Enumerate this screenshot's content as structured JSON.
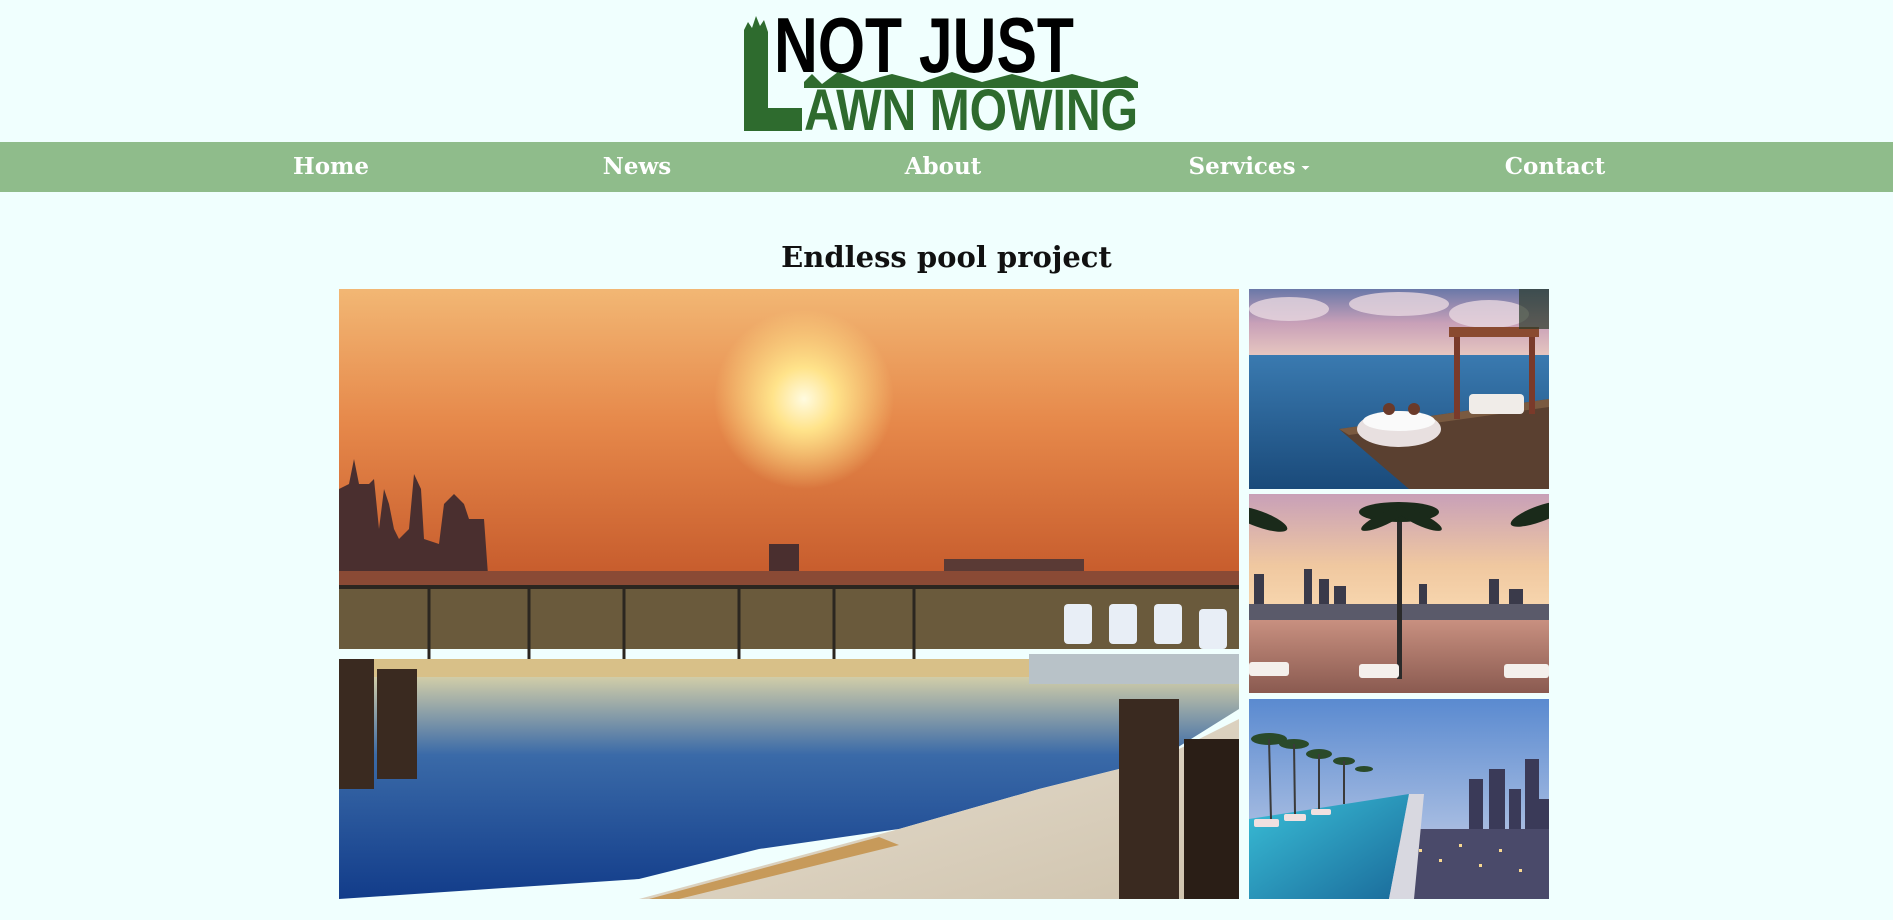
{
  "logo": {
    "line1": "NOT JUST",
    "line2": "AWN MOWING",
    "initial": "L",
    "alt": "Not Just Lawn Mowing logo",
    "color_dark": "#000000",
    "color_green": "#2e6b2e"
  },
  "nav": {
    "items": [
      {
        "label": "Home"
      },
      {
        "label": "News"
      },
      {
        "label": "About"
      },
      {
        "label": "Services",
        "has_dropdown": true
      },
      {
        "label": "Contact"
      }
    ],
    "background": "#8fbc8b",
    "text_color": "#ffffff"
  },
  "page": {
    "title": "Endless pool project",
    "background": "#f0fffe"
  },
  "gallery": {
    "main": {
      "subject": "rooftop infinity pool at sunset with city skyline"
    },
    "thumbs": [
      {
        "subject": "ocean-view infinity pool with cabana daybed"
      },
      {
        "subject": "rooftop infinity pool with palm trees at dusk"
      },
      {
        "subject": "long rooftop infinity pool overlooking city at dusk"
      }
    ]
  }
}
